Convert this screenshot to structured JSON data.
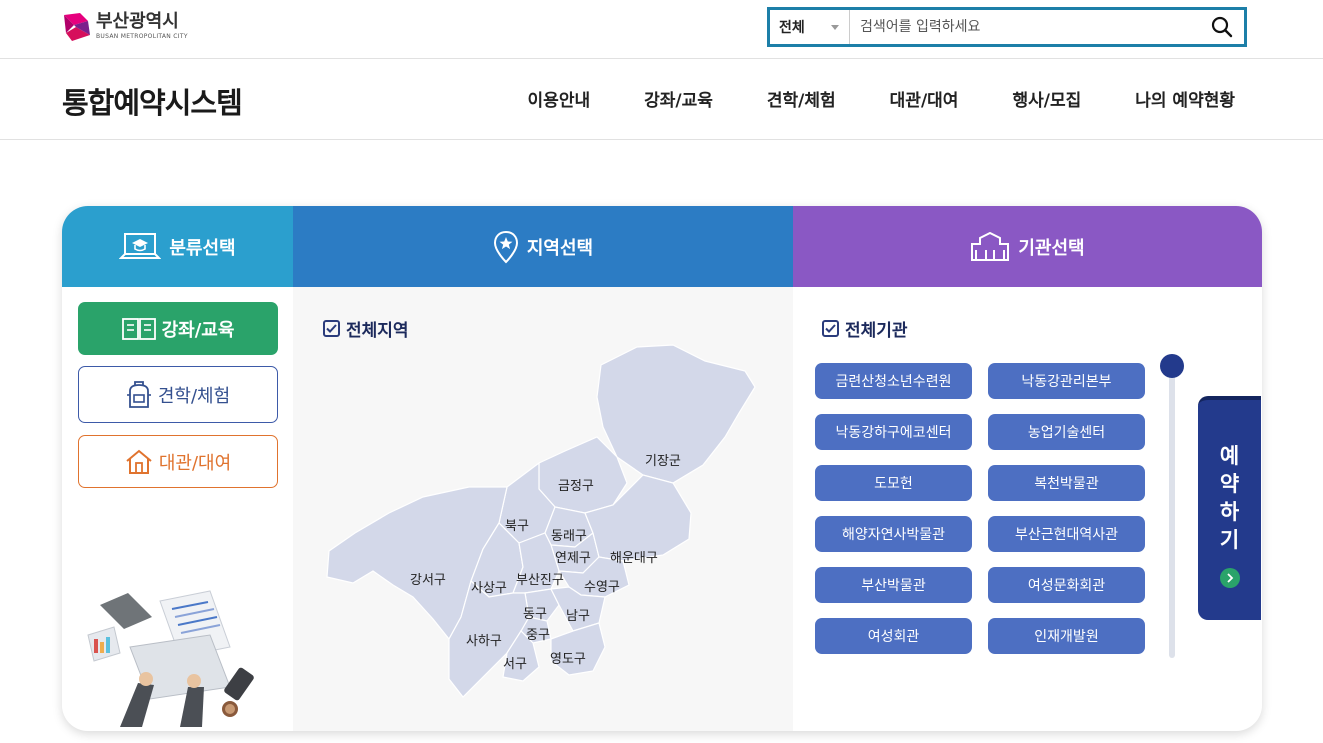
{
  "header": {
    "logo": {
      "name_ko": "부산광역시",
      "name_en": "BUSAN METROPOLITAN CITY"
    },
    "search": {
      "scope": "전체",
      "placeholder": "검색어를 입력하세요"
    }
  },
  "nav": {
    "site_title": "통합예약시스템",
    "items": [
      "이용안내",
      "강좌/교육",
      "견학/체험",
      "대관/대여",
      "행사/모집",
      "나의 예약현황"
    ]
  },
  "panel": {
    "category": {
      "title": "분류선택",
      "buttons": [
        "강좌/교육",
        "견학/체험",
        "대관/대여"
      ],
      "colors": {
        "edu": "#2aa36a",
        "tour": "#3d5aa8",
        "rent": "#e0732e"
      }
    },
    "region": {
      "title": "지역선택",
      "all_label": "전체지역",
      "districts": [
        "기장군",
        "금정구",
        "북구",
        "동래구",
        "연제구",
        "해운대구",
        "강서구",
        "사상구",
        "부산진구",
        "수영구",
        "동구",
        "남구",
        "중구",
        "사하구",
        "서구",
        "영도구"
      ]
    },
    "institution": {
      "title": "기관선택",
      "all_label": "전체기관",
      "items": [
        "금련산청소년수련원",
        "낙동강관리본부",
        "낙동강하구에코센터",
        "농업기술센터",
        "도모헌",
        "복천박물관",
        "해양자연사박물관",
        "부산근현대역사관",
        "부산박물관",
        "여성문화회관",
        "여성회관",
        "인재개발원"
      ]
    },
    "reserve": {
      "chars": [
        "예",
        "약",
        "하",
        "기"
      ]
    }
  },
  "colors": {
    "category_head": "#2b9fce",
    "region_head": "#2c7cc4",
    "institution_head": "#8a58c4",
    "inst_button": "#4d6fc2",
    "search_border": "#1d7fa8"
  }
}
